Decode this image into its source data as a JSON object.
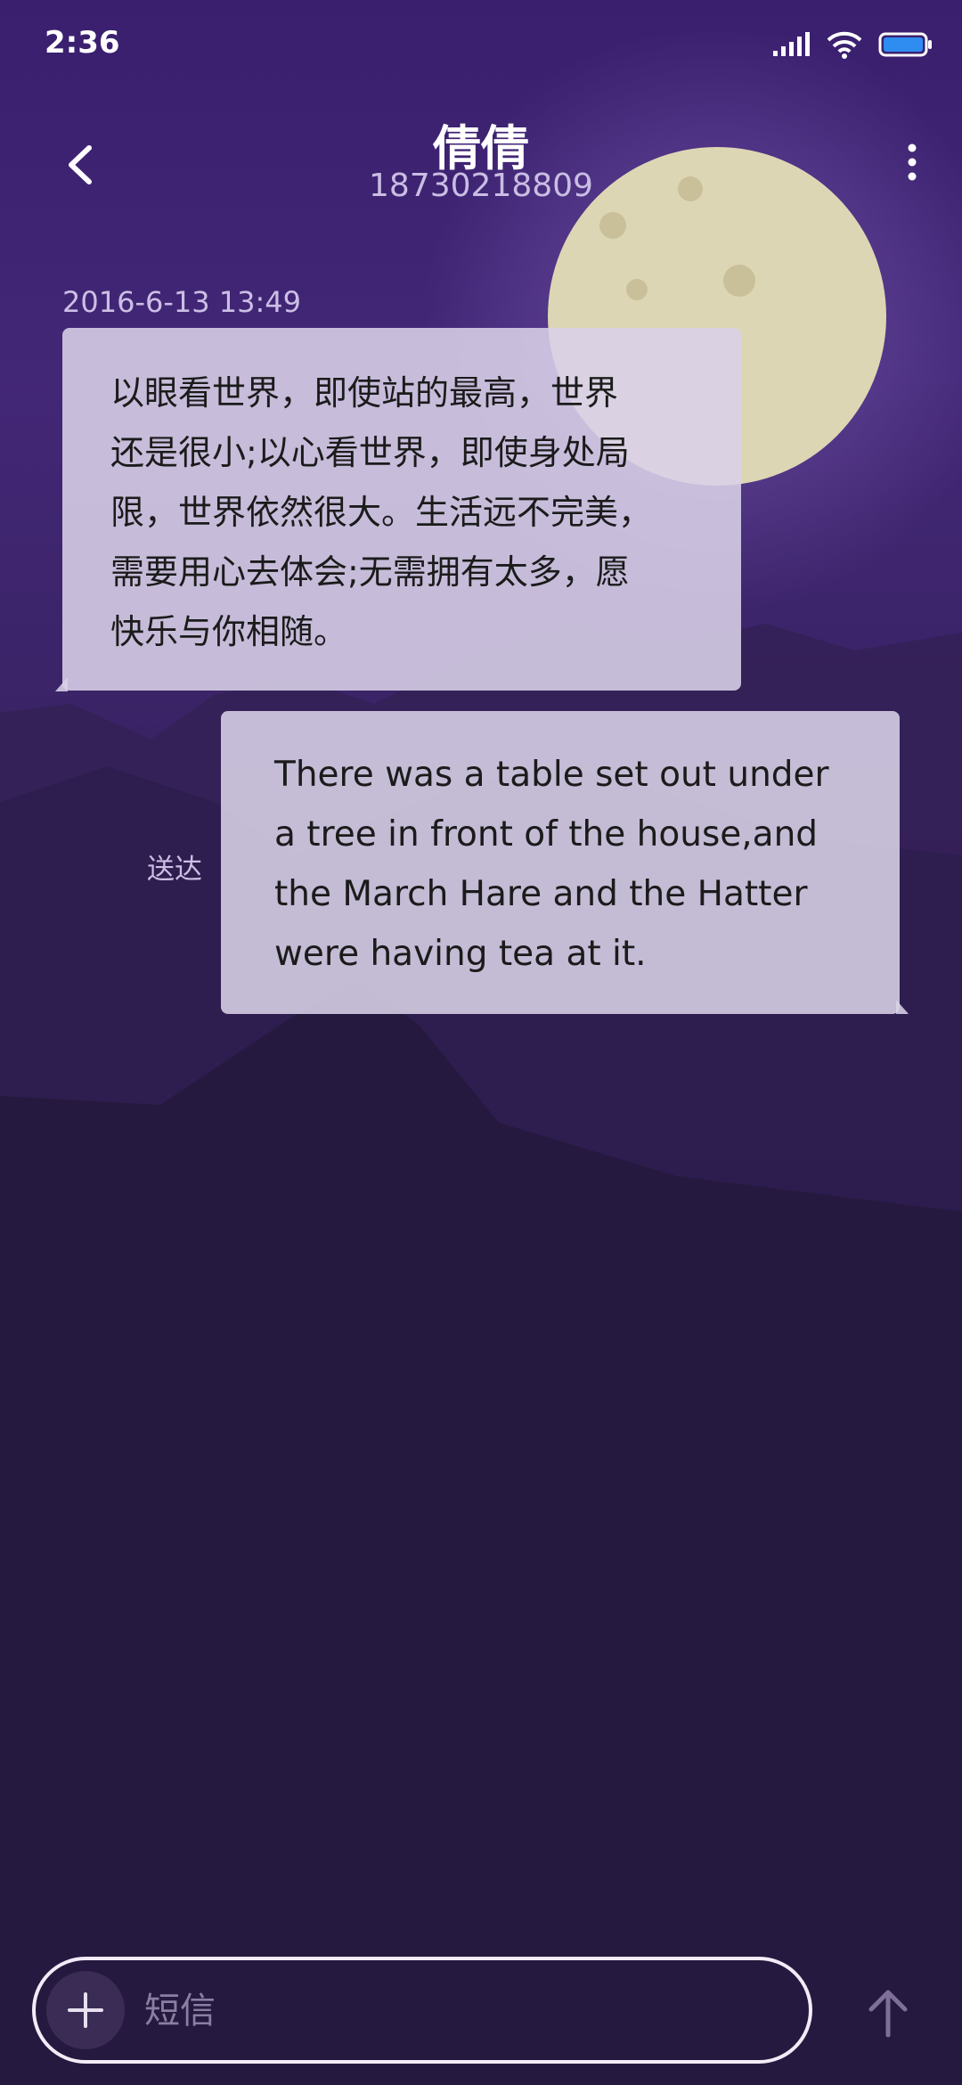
{
  "status_bar": {
    "time": "2:36"
  },
  "header": {
    "contact_name": "倩倩",
    "contact_number": "18730218809"
  },
  "conversation": {
    "timestamp": "2016-6-13 13:49",
    "messages": [
      {
        "direction": "incoming",
        "lines": [
          "以眼看世界，即使站的最高，世界",
          "还是很小;以心看世界，即使身处局",
          "限，世界依然很大。生活远不完美，",
          "需要用心去体会;无需拥有太多，愿",
          "快乐与你相随。"
        ]
      },
      {
        "direction": "outgoing",
        "status": "送达",
        "lines": [
          "There was a table set out under",
          "a tree in front of the house,and",
          "the March Hare and the Hatter",
          "were having tea at it."
        ]
      }
    ]
  },
  "composer": {
    "placeholder": "短信"
  },
  "icons": {
    "back": "chevron-left-icon",
    "more": "more-vertical-icon",
    "add": "plus-icon",
    "send": "arrow-up-icon",
    "signal": "signal-icon",
    "wifi": "wifi-icon",
    "battery": "battery-icon"
  },
  "colors": {
    "bubble": "#dad2e8",
    "background_top": "#3a1f6e",
    "background_bottom": "#22163b",
    "moon": "#ddd6b4"
  }
}
